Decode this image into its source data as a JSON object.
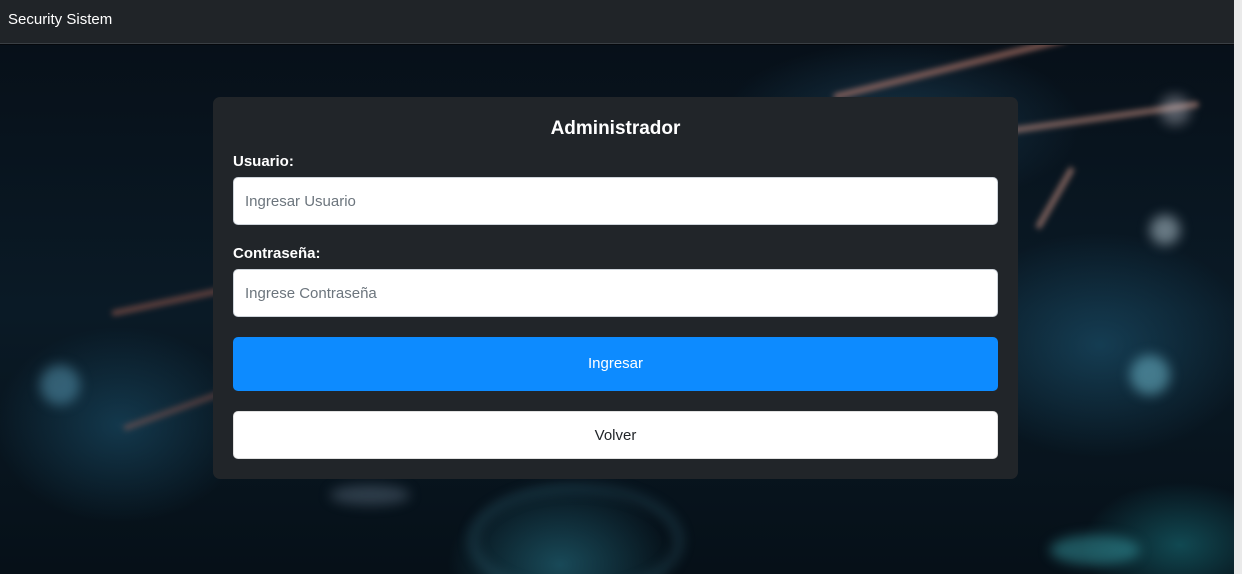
{
  "navbar": {
    "brand": "Security Sistem"
  },
  "login": {
    "title": "Administrador",
    "username_label": "Usuario:",
    "username_placeholder": "Ingresar Usuario",
    "username_value": "",
    "password_label": "Contraseña:",
    "password_placeholder": "Ingrese Contraseña",
    "password_value": "",
    "submit_label": "Ingresar",
    "back_label": "Volver"
  },
  "colors": {
    "navbar_bg": "#202428",
    "card_bg": "#212529",
    "primary": "#0d8bff",
    "text_light": "#ffffff"
  }
}
